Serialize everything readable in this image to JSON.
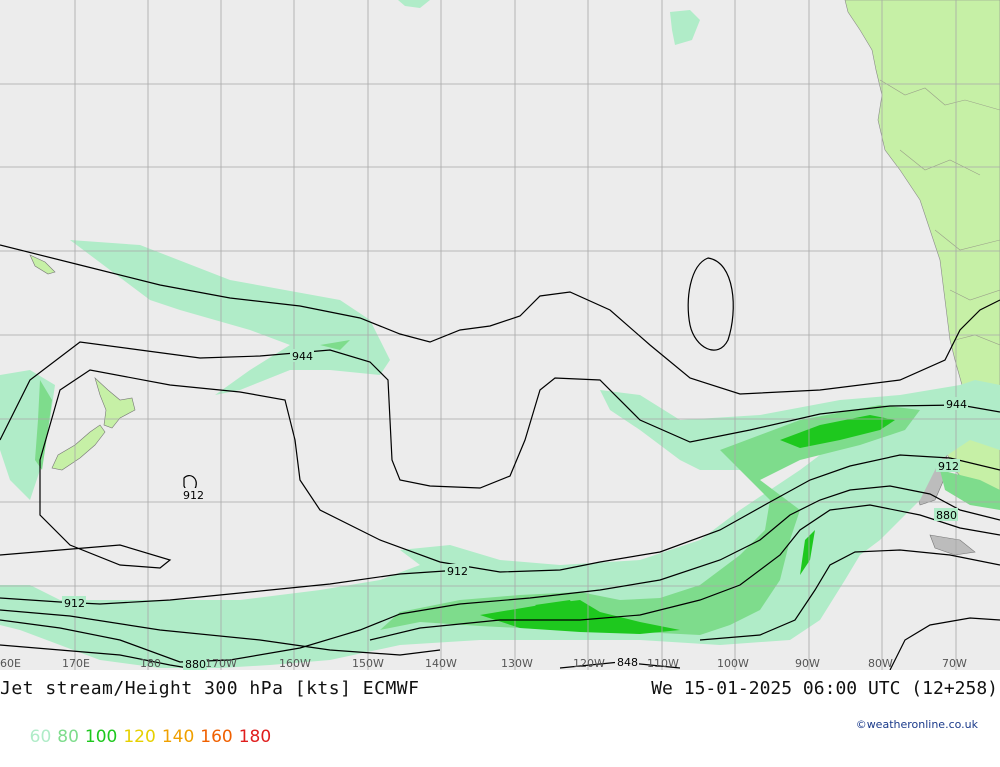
{
  "map": {
    "ocean_color": "#ececec",
    "land_color": "#c6f0a6",
    "grid_color": "#a8a8a8",
    "lon_labels": [
      "60E",
      "170E",
      "180",
      "170W",
      "160W",
      "150W",
      "140W",
      "130W",
      "120W",
      "110W",
      "100W",
      "90W",
      "80W",
      "70W"
    ],
    "contour_labels": {
      "c944_west": "944",
      "c944_east": "944",
      "c912_closed": "912",
      "c912_mid": "912",
      "c912_west": "912",
      "c912_east": "912",
      "c880_west": "880",
      "c880_east": "880",
      "c848": "848"
    },
    "jet_colors": {
      "60": "#b0ecc8",
      "80": "#7edc8c",
      "100": "#1ec81e"
    }
  },
  "footer": {
    "title": "Jet stream/Height 300 hPa [kts] ECMWF",
    "datetime": "We 15-01-2025 06:00 UTC (12+258)",
    "legend": [
      {
        "label": "60",
        "color": "#b0ecc8"
      },
      {
        "label": "80",
        "color": "#7edc8c"
      },
      {
        "label": "100",
        "color": "#1ec81e"
      },
      {
        "label": "120",
        "color": "#e6d000"
      },
      {
        "label": "140",
        "color": "#f0a000"
      },
      {
        "label": "160",
        "color": "#f06000"
      },
      {
        "label": "180",
        "color": "#e01e1e"
      }
    ],
    "credit": "©weatheronline.co.uk"
  }
}
